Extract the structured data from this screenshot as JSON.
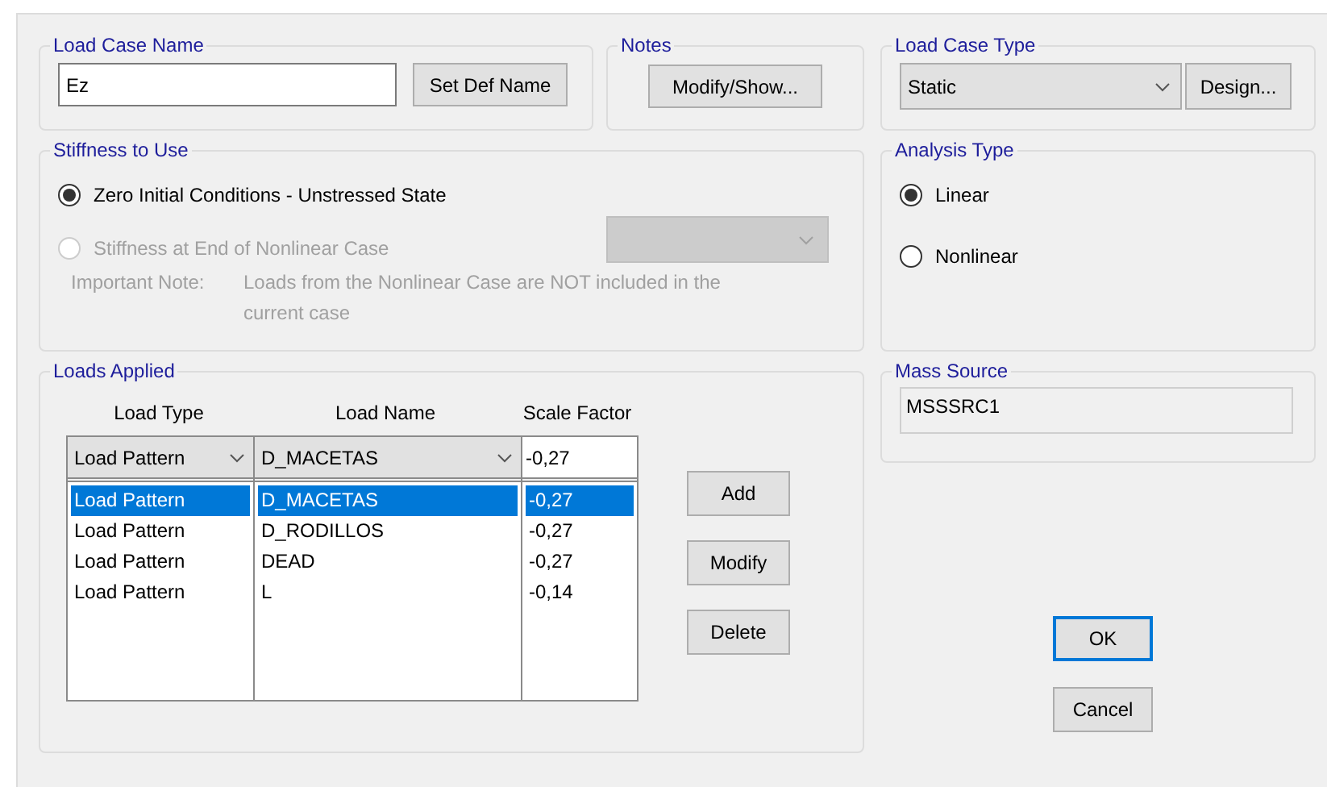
{
  "load_case_name": {
    "label": "Load Case Name",
    "value": "Ez",
    "button": "Set Def Name"
  },
  "notes": {
    "label": "Notes",
    "button": "Modify/Show..."
  },
  "load_case_type": {
    "label": "Load Case Type",
    "value": "Static",
    "button": "Design..."
  },
  "stiffness": {
    "label": "Stiffness to Use",
    "options": [
      {
        "label": "Zero Initial Conditions - Unstressed State",
        "selected": true,
        "disabled": false
      },
      {
        "label": "Stiffness at End of Nonlinear Case",
        "selected": false,
        "disabled": true
      }
    ],
    "note_label": "Important Note:",
    "note": "Loads from the Nonlinear Case are NOT included in the current case"
  },
  "analysis_type": {
    "label": "Analysis Type",
    "options": [
      {
        "label": "Linear",
        "selected": true
      },
      {
        "label": "Nonlinear",
        "selected": false
      }
    ]
  },
  "loads_applied": {
    "label": "Loads Applied",
    "columns": [
      "Load Type",
      "Load Name",
      "Scale Factor"
    ],
    "editor": {
      "load_type": "Load Pattern",
      "load_name": "D_MACETAS",
      "scale_factor": "-0,27"
    },
    "rows": [
      {
        "load_type": "Load Pattern",
        "load_name": "D_MACETAS",
        "scale_factor": "-0,27",
        "selected": true
      },
      {
        "load_type": "Load Pattern",
        "load_name": "D_RODILLOS",
        "scale_factor": "-0,27",
        "selected": false
      },
      {
        "load_type": "Load Pattern",
        "load_name": "DEAD",
        "scale_factor": "-0,27",
        "selected": false
      },
      {
        "load_type": "Load Pattern",
        "load_name": "L",
        "scale_factor": "-0,14",
        "selected": false
      }
    ],
    "buttons": [
      "Add",
      "Modify",
      "Delete"
    ]
  },
  "mass_source": {
    "label": "Mass Source",
    "value": "MSSSRC1"
  },
  "dialog_buttons": [
    {
      "label": "OK",
      "default": true
    },
    {
      "label": "Cancel",
      "default": false
    }
  ]
}
